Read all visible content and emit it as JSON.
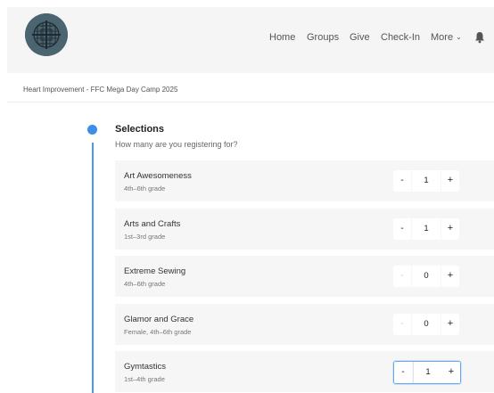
{
  "nav": {
    "home": "Home",
    "groups": "Groups",
    "give": "Give",
    "checkin": "Check-In",
    "more": "More",
    "more_icon": "chevron-down-icon",
    "bell_icon": "bell-icon",
    "logo_icon": "globe-cross-logo"
  },
  "breadcrumb": "Heart Improvement - FFC Mega Day Camp 2025",
  "selections": {
    "title": "Selections",
    "subtitle": "How many are you registering for?",
    "items": [
      {
        "name": "Art Awesomeness",
        "grade": "4th–6th grade",
        "count": "1",
        "minus_enabled": true
      },
      {
        "name": "Arts and Crafts",
        "grade": "1st–3rd grade",
        "count": "1",
        "minus_enabled": true
      },
      {
        "name": "Extreme Sewing",
        "grade": "4th–6th grade",
        "count": "0",
        "minus_enabled": false
      },
      {
        "name": "Glamor and Grace",
        "grade": "Female, 4th–6th grade",
        "count": "0",
        "minus_enabled": false
      },
      {
        "name": "Gymtastics",
        "grade": "1st–4th grade",
        "count": "1",
        "minus_enabled": true
      }
    ],
    "minus_label": "-",
    "plus_label": "+"
  },
  "colors": {
    "accent": "#3b8fe4",
    "header_bg": "#f5f5f5",
    "card_bg": "#f6f6f6"
  }
}
